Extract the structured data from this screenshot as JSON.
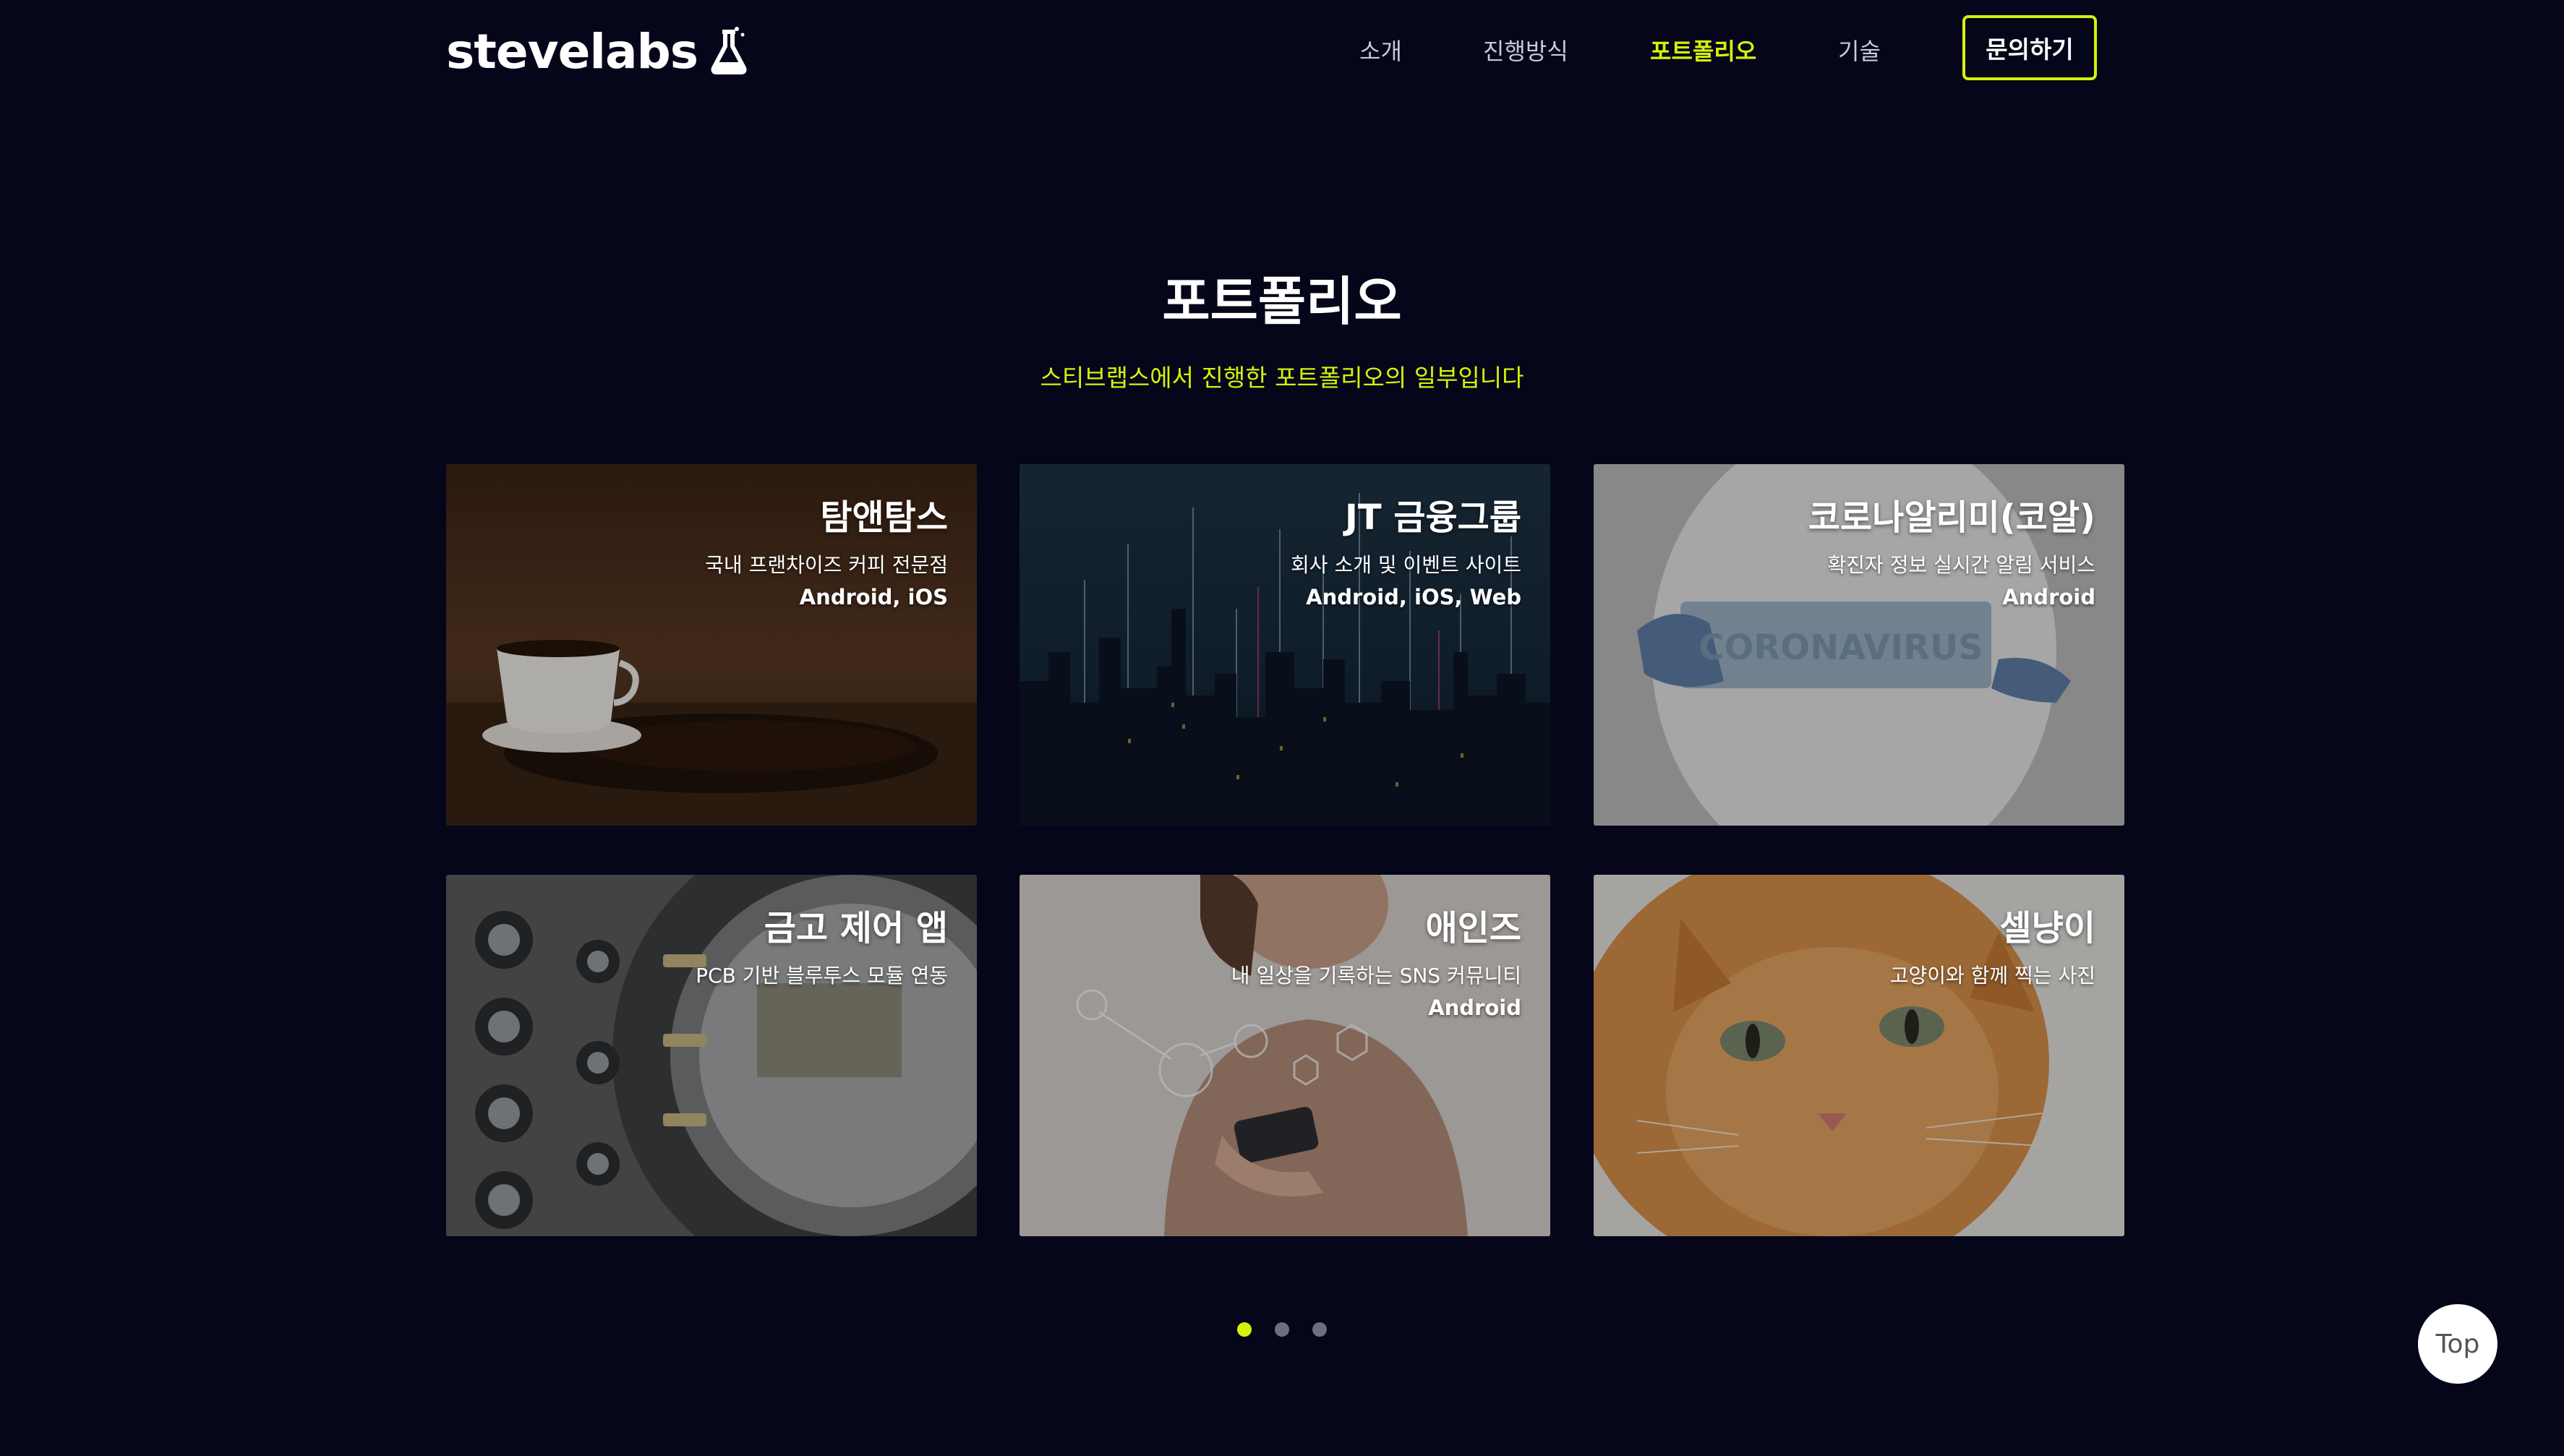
{
  "header": {
    "logo_text": "stevelabs",
    "logo_icon": "flask-icon",
    "nav": [
      {
        "label": "소개",
        "active": false
      },
      {
        "label": "진행방식",
        "active": false
      },
      {
        "label": "포트폴리오",
        "active": true
      },
      {
        "label": "기술",
        "active": false
      }
    ],
    "contact_label": "문의하기"
  },
  "section": {
    "title": "포트폴리오",
    "subtitle": "스티브랩스에서 진행한 포트폴리오의 일부입니다"
  },
  "cards": [
    {
      "title": "탐앤탐스",
      "desc": "국내 프랜차이즈 커피 전문점",
      "platform": "Android, iOS",
      "image": "coffee-cup-and-beans"
    },
    {
      "title": "JT 금융그룹",
      "desc": "회사 소개 및 이벤트 사이트",
      "platform": "Android, iOS, Web",
      "image": "city-skyline-data-lines"
    },
    {
      "title": "코로나알리미(코알)",
      "desc": "확진자 정보 실시간 알림 서비스",
      "platform": "Android",
      "image": "coronavirus-sign-gloved-hands"
    },
    {
      "title": "금고 제어 앱",
      "desc": "PCB 기반 블루투스 모듈 연동",
      "platform": "",
      "image": "bank-vault-door"
    },
    {
      "title": "애인즈",
      "desc": "내 일상을 기록하는 SNS 커뮤니티",
      "platform": "Android",
      "image": "woman-with-phone-social-icons"
    },
    {
      "title": "셀냥이",
      "desc": "고양이와 함께 찍는 사진",
      "platform": "",
      "image": "orange-cat-selfie"
    }
  ],
  "pagination": {
    "pages": 3,
    "current": 1
  },
  "top_button_label": "Top",
  "colors": {
    "background": "#05061a",
    "accent": "#d5f20a",
    "nav_text": "#c9c9d2"
  }
}
